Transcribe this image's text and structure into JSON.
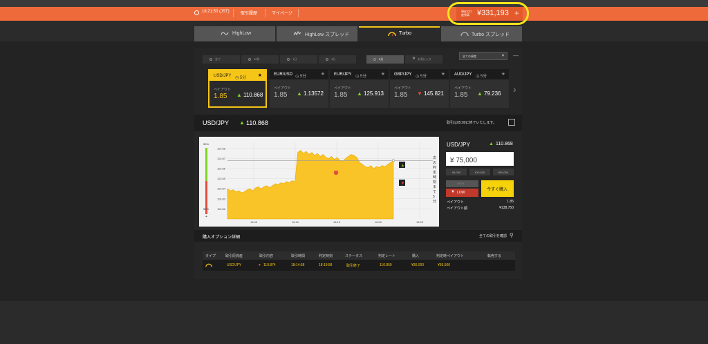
{
  "header": {
    "time": "18:21:50 (JST)",
    "nav": [
      "取引履歴",
      "マイページ"
    ],
    "balance_label": "現在の口座残高",
    "balance": "¥331,193",
    "plus": "+"
  },
  "tabs": [
    {
      "label": "HighLow",
      "active": false
    },
    {
      "label": "HighLow スプレッド",
      "active": false
    },
    {
      "label": "Turbo",
      "active": true
    },
    {
      "label": "Turbo スプレッド",
      "active": false
    }
  ],
  "filters": [
    {
      "label": "全て",
      "selected": false
    },
    {
      "label": "30秒",
      "selected": false
    },
    {
      "label": "1分",
      "selected": false
    },
    {
      "label": "3分",
      "selected": false
    },
    {
      "label": "5分",
      "selected": true
    },
    {
      "label": "お気に入り",
      "selected": false
    }
  ],
  "dropdown": {
    "value": "全ての資産"
  },
  "assets": [
    {
      "pair": "USD/JPY",
      "duration": "5分",
      "payout_label": "ペイアウト",
      "payout": "1.85",
      "direction": "up",
      "rate": "110.868",
      "selected": true
    },
    {
      "pair": "EUR/USD",
      "duration": "5分",
      "payout_label": "ペイアウト",
      "payout": "1.85",
      "direction": "up",
      "rate": "1.13572",
      "selected": false
    },
    {
      "pair": "EUR/JPY",
      "duration": "5分",
      "payout_label": "ペイアウト",
      "payout": "1.85",
      "direction": "up",
      "rate": "125.913",
      "selected": false
    },
    {
      "pair": "GBP/JPY",
      "duration": "5分",
      "payout_label": "ペイアウト",
      "payout": "1.85",
      "direction": "down",
      "rate": "145.821",
      "selected": false
    },
    {
      "pair": "AUD/JPY",
      "duration": "5分",
      "payout_label": "ペイアウト",
      "payout": "1.85",
      "direction": "up",
      "rate": "79.236",
      "selected": false
    }
  ],
  "asset_header": {
    "pair": "USD/JPY",
    "rate": "110.868",
    "note": "取引は05:00に終了いたします。"
  },
  "chart_data": {
    "type": "area",
    "x": [
      "18:05",
      "18:10",
      "18:15",
      "18:20",
      "18:25"
    ],
    "yticks": [
      "110.88",
      "110.87",
      "110.86",
      "110.85",
      "110.84",
      "110.83",
      "110.82"
    ],
    "ylim": [
      110.81,
      110.886
    ],
    "sentiment_top": "50%",
    "sentiment_bottom": "50%",
    "side_text": "次の判定時刻まで5分",
    "strike": 110.868,
    "series": [
      {
        "values": [
          110.84,
          110.838,
          110.839,
          110.837,
          110.838,
          110.836,
          110.837,
          110.839,
          110.84,
          110.838,
          110.841,
          110.842,
          110.84,
          110.842,
          110.843,
          110.841,
          110.843,
          110.845,
          110.844,
          110.846,
          110.845,
          110.847,
          110.846,
          110.848,
          110.847,
          110.876,
          110.878,
          110.875,
          110.877,
          110.874,
          110.876,
          110.873,
          110.875,
          110.872,
          110.874,
          110.871,
          110.87,
          110.872,
          110.869,
          110.871,
          110.868,
          110.867,
          110.87,
          110.872,
          110.874,
          110.873,
          110.871,
          110.866,
          110.864,
          110.862,
          110.861,
          110.863,
          110.86,
          110.862,
          110.861,
          110.863,
          110.862,
          110.864,
          110.866,
          110.868
        ]
      }
    ]
  },
  "trade": {
    "pair": "USD/JPY",
    "rate": "110.868",
    "amount": "¥ 75,000",
    "presets": [
      "¥5,000",
      "¥10,000",
      "¥50,000"
    ],
    "high_label": "HIGH",
    "low_label": "LOW",
    "buy_label": "今すぐ購入",
    "payout_label": "ペイアウト",
    "payout_value": "1.85",
    "payout_amount_label": "ペイアウト額",
    "payout_amount_value": "¥138,750"
  },
  "details": {
    "title": "購入オプション詳細",
    "link": "全ての取引を確認",
    "columns": [
      "タイプ",
      "取引原資産",
      "取引内容",
      "取引時間",
      "判定時刻",
      "ステータス",
      "判定レート",
      "購入",
      "判定時ペイアウト",
      "転売する"
    ],
    "rows": [
      {
        "asset": "USD/JPY",
        "content": "110.874",
        "time": "18:14:58",
        "expiry": "18:19:58",
        "status": "取引終了",
        "rate": "110.859",
        "amount": "¥30,000",
        "payout": "¥55,500"
      }
    ]
  },
  "colors": {
    "accent": "#f5c518",
    "orange": "#ef6a3a",
    "up": "#7ed321",
    "down": "#e74c3c"
  }
}
